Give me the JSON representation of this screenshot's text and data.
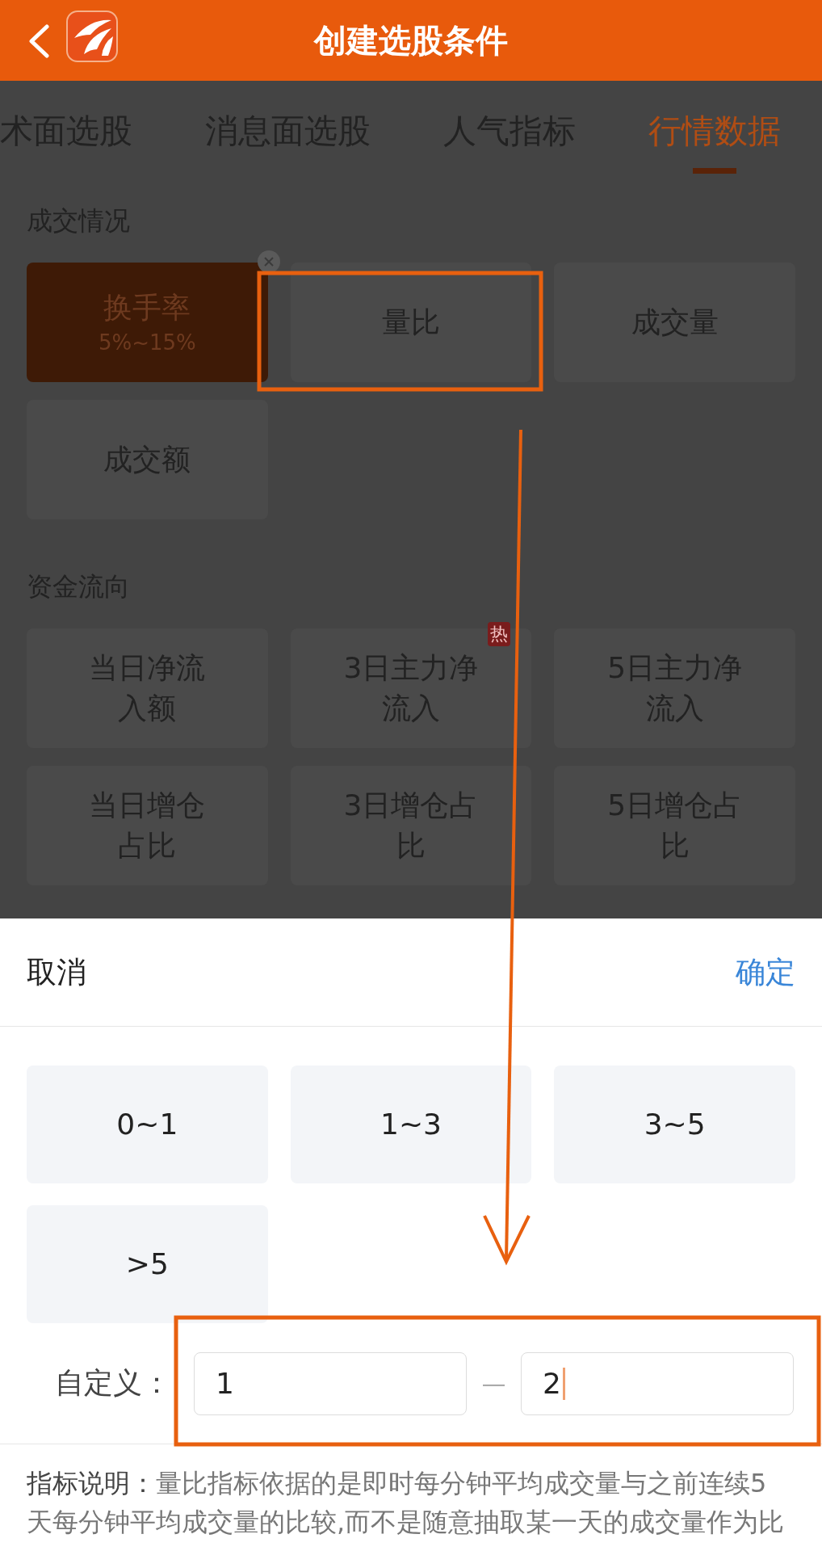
{
  "header": {
    "title": "创建选股条件"
  },
  "tabs": [
    {
      "label": "术面选股",
      "selected": false
    },
    {
      "label": "消息面选股",
      "selected": false
    },
    {
      "label": "人气指标",
      "selected": false
    },
    {
      "label": "行情数据",
      "selected": true
    }
  ],
  "sections": [
    {
      "title": "成交情况",
      "items": [
        {
          "lines": [
            "换手率"
          ],
          "value": "5%~15%",
          "selected": true
        },
        {
          "lines": [
            "量比"
          ],
          "selected": false
        },
        {
          "lines": [
            "成交量"
          ],
          "selected": false
        },
        {
          "lines": [
            "成交额"
          ],
          "selected": false
        }
      ]
    },
    {
      "title": "资金流向",
      "items": [
        {
          "lines": [
            "当日净流",
            "入额"
          ],
          "selected": false
        },
        {
          "lines": [
            "3日主力净",
            "流入"
          ],
          "selected": false,
          "badge": "热"
        },
        {
          "lines": [
            "5日主力净",
            "流入"
          ],
          "selected": false
        },
        {
          "lines": [
            "当日增仓",
            "占比"
          ],
          "selected": false
        },
        {
          "lines": [
            "3日增仓占",
            "比"
          ],
          "selected": false
        },
        {
          "lines": [
            "5日增仓占",
            "比"
          ],
          "selected": false
        }
      ]
    }
  ],
  "sheet": {
    "cancel": "取消",
    "confirm": "确定",
    "options": [
      {
        "label": "0~1",
        "selected": false
      },
      {
        "label": "1~3",
        "selected": false
      },
      {
        "label": "3~5",
        "selected": false
      },
      {
        "label": ">5",
        "selected": false
      }
    ],
    "custom": {
      "label": "自定义：",
      "min": "1",
      "separator": "—",
      "max": "2",
      "max_focused": true
    },
    "note": "**指标说明：**量比指标依据的是即时每分钟平均成交量与之前连续5天每分钟平均成交量的比较,而不是随意抽取某一天的成交量作为比"
  }
}
